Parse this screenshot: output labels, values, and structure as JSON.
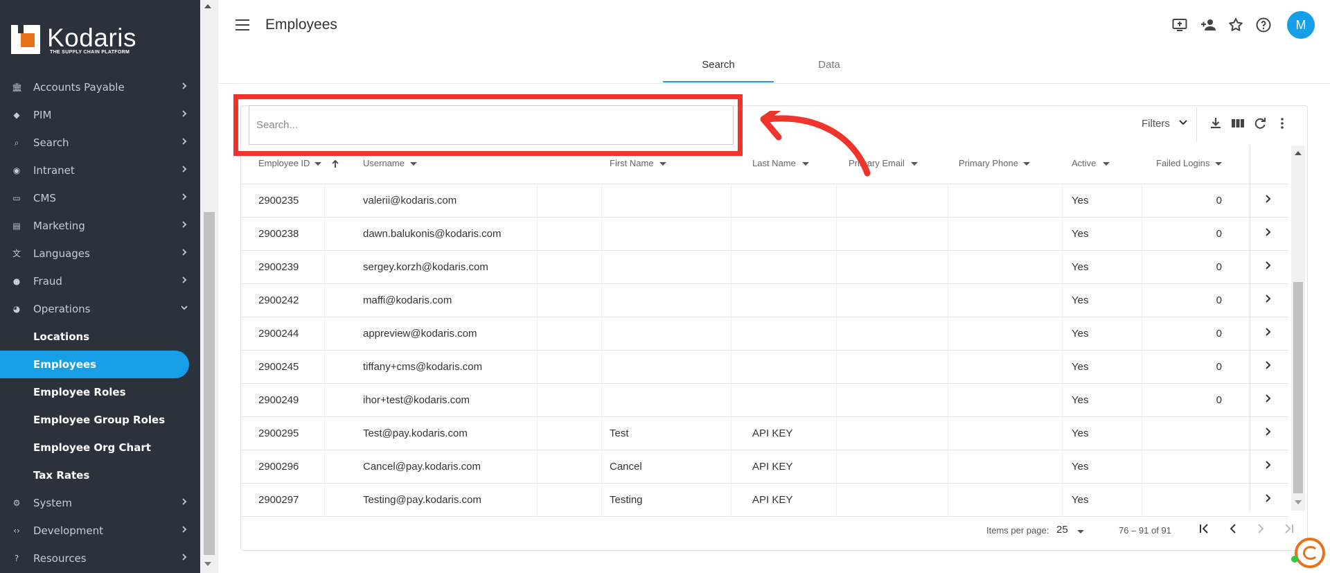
{
  "brand": {
    "name": "Kodaris",
    "tagline": "THE SUPPLY CHAIN PLATFORM"
  },
  "sidebar": {
    "items": [
      {
        "label": "Accounts Payable",
        "icon": "bank-icon"
      },
      {
        "label": "PIM",
        "icon": "tag-icon"
      },
      {
        "label": "Search",
        "icon": "search-icon"
      },
      {
        "label": "Intranet",
        "icon": "globe-icon"
      },
      {
        "label": "CMS",
        "icon": "web-icon"
      },
      {
        "label": "Marketing",
        "icon": "campaign-icon"
      },
      {
        "label": "Languages",
        "icon": "translate-icon"
      },
      {
        "label": "Fraud",
        "icon": "alert-icon"
      },
      {
        "label": "Operations",
        "icon": "operations-icon"
      }
    ],
    "sub_items": [
      "Locations",
      "Employees",
      "Employee Roles",
      "Employee Group Roles",
      "Employee Org Chart",
      "Tax Rates"
    ],
    "bottom_items": [
      {
        "label": "System",
        "icon": "gear-icon"
      },
      {
        "label": "Development",
        "icon": "code-icon"
      },
      {
        "label": "Resources",
        "icon": "help-icon"
      }
    ]
  },
  "header": {
    "title": "Employees",
    "avatar_initial": "M"
  },
  "tabs": [
    "Search",
    "Data"
  ],
  "search": {
    "placeholder": "Search...",
    "filters_label": "Filters"
  },
  "table": {
    "columns": [
      "Employee ID",
      "Username",
      "First Name",
      "Last Name",
      "Primary Email",
      "Primary Phone",
      "Active",
      "Failed Logins"
    ],
    "rows": [
      {
        "id": "2900235",
        "username": "valerii@kodaris.com",
        "first": "",
        "last": "",
        "active": "Yes",
        "failed": "0"
      },
      {
        "id": "2900238",
        "username": "dawn.balukonis@kodaris.com",
        "first": "",
        "last": "",
        "active": "Yes",
        "failed": "0"
      },
      {
        "id": "2900239",
        "username": "sergey.korzh@kodaris.com",
        "first": "",
        "last": "",
        "active": "Yes",
        "failed": "0"
      },
      {
        "id": "2900242",
        "username": "maffi@kodaris.com",
        "first": "",
        "last": "",
        "active": "Yes",
        "failed": "0"
      },
      {
        "id": "2900244",
        "username": "appreview@kodaris.com",
        "first": "",
        "last": "",
        "active": "Yes",
        "failed": "0"
      },
      {
        "id": "2900245",
        "username": "tiffany+cms@kodaris.com",
        "first": "",
        "last": "",
        "active": "Yes",
        "failed": "0"
      },
      {
        "id": "2900249",
        "username": "ihor+test@kodaris.com",
        "first": "",
        "last": "",
        "active": "Yes",
        "failed": "0"
      },
      {
        "id": "2900295",
        "username": "Test@pay.kodaris.com",
        "first": "Test",
        "last": "API KEY",
        "active": "Yes",
        "failed": ""
      },
      {
        "id": "2900296",
        "username": "Cancel@pay.kodaris.com",
        "first": "Cancel",
        "last": "API KEY",
        "active": "Yes",
        "failed": ""
      },
      {
        "id": "2900297",
        "username": "Testing@pay.kodaris.com",
        "first": "Testing",
        "last": "API KEY",
        "active": "Yes",
        "failed": ""
      }
    ]
  },
  "paginator": {
    "label": "Items per page:",
    "page_size": "25",
    "range": "76 – 91 of 91"
  },
  "colors": {
    "accent": "#169ee6",
    "sidebar_bg": "#2b323b",
    "highlight": "#f0342c",
    "brand_orange": "#e8711c"
  }
}
